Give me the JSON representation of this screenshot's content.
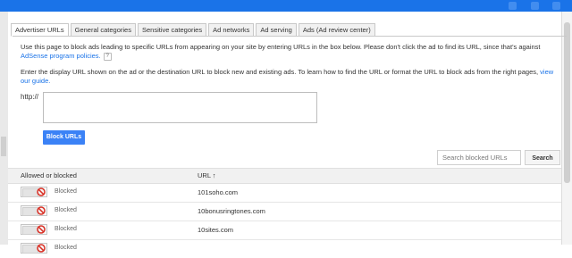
{
  "tabs": [
    {
      "label": "Advertiser URLs",
      "active": true
    },
    {
      "label": "General categories",
      "active": false
    },
    {
      "label": "Sensitive categories",
      "active": false
    },
    {
      "label": "Ad networks",
      "active": false
    },
    {
      "label": "Ad serving",
      "active": false
    },
    {
      "label": "Ads (Ad review center)",
      "active": false
    }
  ],
  "intro": {
    "line1": "Use this page to block ads leading to specific URLs from appearing on your site by entering URLs in the box below. Please don't click the ad to find its URL, since that's against",
    "link": "AdSense program policies.",
    "help": "?"
  },
  "instructions": {
    "text": "Enter the display URL shown on the ad or the destination URL to block new and existing ads. To learn how to find the URL or format the URL to block ads from the right pages,",
    "link": "view our guide."
  },
  "url_entry": {
    "prefix": "http://",
    "value": "",
    "button_label": "Block URLs"
  },
  "search": {
    "placeholder": "Search blocked URLs",
    "button_label": "Search"
  },
  "table": {
    "headers": {
      "status": "Allowed or blocked",
      "url": "URL ↑"
    },
    "rows": [
      {
        "status": "Blocked",
        "url": "101soho.com"
      },
      {
        "status": "Blocked",
        "url": "10bonusringtones.com"
      },
      {
        "status": "Blocked",
        "url": "10sites.com"
      },
      {
        "status": "Blocked",
        "url": ""
      }
    ]
  },
  "colors": {
    "accent": "#1a73e8",
    "button": "#3b82f6",
    "blocked_icon": "#d93025"
  }
}
